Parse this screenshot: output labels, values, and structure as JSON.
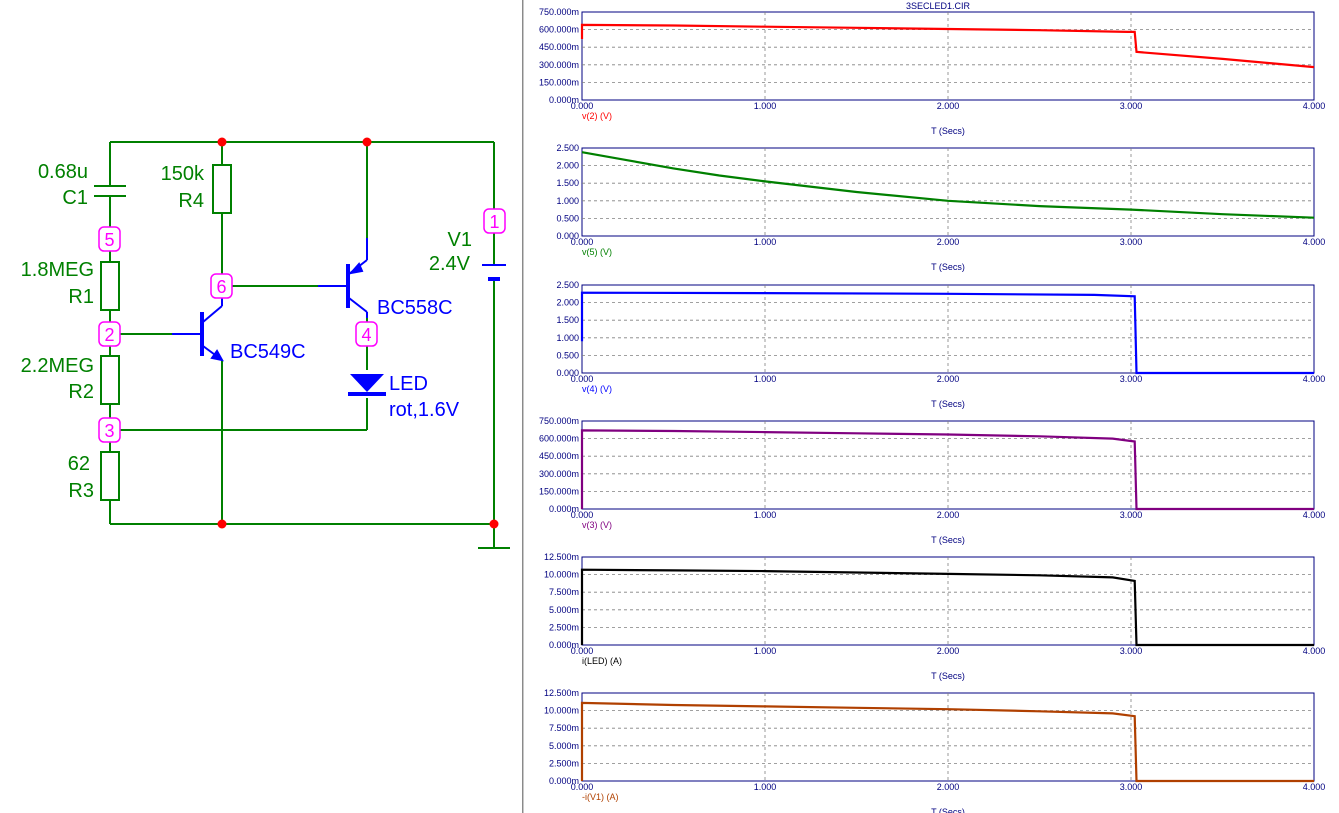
{
  "schematic": {
    "components": {
      "c1": {
        "value": "0.68u",
        "name": "C1"
      },
      "r4": {
        "value": "150k",
        "name": "R4"
      },
      "r1": {
        "value": "1.8MEG",
        "name": "R1"
      },
      "r2": {
        "value": "2.2MEG",
        "name": "R2"
      },
      "r3": {
        "value": "62",
        "name": "R3"
      },
      "v1": {
        "name": "V1",
        "value": "2.4V"
      },
      "q1": {
        "name": "BC549C"
      },
      "q2": {
        "name": "BC558C"
      },
      "led": {
        "name": "LED",
        "value": "rot,1.6V"
      }
    },
    "nodes": [
      "1",
      "2",
      "3",
      "4",
      "5",
      "6"
    ]
  },
  "plot_window": {
    "title": "3SECLED1.CIR"
  },
  "colors": {
    "wire": "#008000",
    "transistor": "#0000ff",
    "node_label": "#ff00ff",
    "junction": "#ff0000",
    "axis_text": "#000080"
  },
  "chart_data": [
    {
      "type": "line",
      "ylabel": "v(2) (V)",
      "xlabel": "T (Secs)",
      "color": "#ff0000",
      "x_ticks": [
        "0.000",
        "1.000",
        "2.000",
        "3.000",
        "4.000"
      ],
      "y_ticks": [
        "750.000m",
        "600.000m",
        "450.000m",
        "300.000m",
        "150.000m",
        "0.000m"
      ],
      "xlim": [
        0,
        4
      ],
      "ylim": [
        0,
        0.75
      ],
      "x": [
        0,
        0.0,
        0.5,
        1.0,
        1.5,
        2.0,
        2.5,
        2.98,
        3.02,
        3.03,
        3.5,
        4.0
      ],
      "y": [
        0.52,
        0.64,
        0.635,
        0.625,
        0.615,
        0.605,
        0.595,
        0.58,
        0.58,
        0.41,
        0.35,
        0.28
      ]
    },
    {
      "type": "line",
      "ylabel": "v(5) (V)",
      "xlabel": "T (Secs)",
      "color": "#008000",
      "x_ticks": [
        "0.000",
        "1.000",
        "2.000",
        "3.000",
        "4.000"
      ],
      "y_ticks": [
        "2.500",
        "2.000",
        "1.500",
        "1.000",
        "0.500",
        "0.000"
      ],
      "xlim": [
        0,
        4
      ],
      "ylim": [
        0,
        2.5
      ],
      "x": [
        0,
        0.25,
        0.5,
        0.75,
        1.0,
        1.5,
        2.0,
        2.5,
        3.0,
        3.5,
        4.0
      ],
      "y": [
        2.38,
        2.15,
        1.92,
        1.72,
        1.55,
        1.25,
        1.0,
        0.85,
        0.75,
        0.62,
        0.52
      ]
    },
    {
      "type": "line",
      "ylabel": "v(4) (V)",
      "xlabel": "T (Secs)",
      "color": "#0000ff",
      "x_ticks": [
        "0.000",
        "1.000",
        "2.000",
        "3.000",
        "4.000"
      ],
      "y_ticks": [
        "2.500",
        "2.000",
        "1.500",
        "1.000",
        "0.500",
        "0.000"
      ],
      "xlim": [
        0,
        4
      ],
      "ylim": [
        0,
        2.5
      ],
      "x": [
        0,
        0.0,
        1.0,
        2.0,
        2.8,
        3.02,
        3.03,
        4.0
      ],
      "y": [
        0.9,
        2.28,
        2.27,
        2.25,
        2.22,
        2.18,
        0.0,
        0.0
      ]
    },
    {
      "type": "line",
      "ylabel": "v(3) (V)",
      "xlabel": "T (Secs)",
      "color": "#800080",
      "x_ticks": [
        "0.000",
        "1.000",
        "2.000",
        "3.000",
        "4.000"
      ],
      "y_ticks": [
        "750.000m",
        "600.000m",
        "450.000m",
        "300.000m",
        "150.000m",
        "0.000m"
      ],
      "xlim": [
        0,
        4
      ],
      "ylim": [
        0,
        0.75
      ],
      "x": [
        0,
        0.0,
        0.5,
        1.0,
        1.5,
        2.0,
        2.5,
        2.9,
        3.02,
        3.03,
        4.0
      ],
      "y": [
        0.0,
        0.67,
        0.665,
        0.655,
        0.645,
        0.635,
        0.62,
        0.6,
        0.575,
        0.0,
        0.0
      ]
    },
    {
      "type": "line",
      "ylabel": "i(LED) (A)",
      "xlabel": "T (Secs)",
      "color": "#000000",
      "x_ticks": [
        "0.000",
        "1.000",
        "2.000",
        "3.000",
        "4.000"
      ],
      "y_ticks": [
        "12.500m",
        "10.000m",
        "7.500m",
        "5.000m",
        "2.500m",
        "0.000m"
      ],
      "xlim": [
        0,
        4
      ],
      "ylim": [
        0,
        0.0125
      ],
      "x": [
        0,
        0.0,
        0.5,
        1.0,
        1.5,
        2.0,
        2.5,
        2.9,
        3.02,
        3.03,
        4.0
      ],
      "y": [
        0.0,
        0.0107,
        0.0106,
        0.0105,
        0.0103,
        0.0101,
        0.0099,
        0.0096,
        0.0091,
        0.0,
        0.0
      ]
    },
    {
      "type": "line",
      "ylabel": "-i(V1) (A)",
      "xlabel": "T (Secs)",
      "color": "#b04000",
      "x_ticks": [
        "0.000",
        "1.000",
        "2.000",
        "3.000",
        "4.000"
      ],
      "y_ticks": [
        "12.500m",
        "10.000m",
        "7.500m",
        "5.000m",
        "2.500m",
        "0.000m"
      ],
      "xlim": [
        0,
        4
      ],
      "ylim": [
        0,
        0.0125
      ],
      "x": [
        0,
        0.0,
        0.5,
        1.0,
        1.5,
        2.0,
        2.5,
        2.9,
        3.02,
        3.03,
        4.0
      ],
      "y": [
        0.0,
        0.0111,
        0.0108,
        0.0106,
        0.0104,
        0.0102,
        0.0099,
        0.0096,
        0.0092,
        0.0,
        0.0
      ]
    }
  ]
}
